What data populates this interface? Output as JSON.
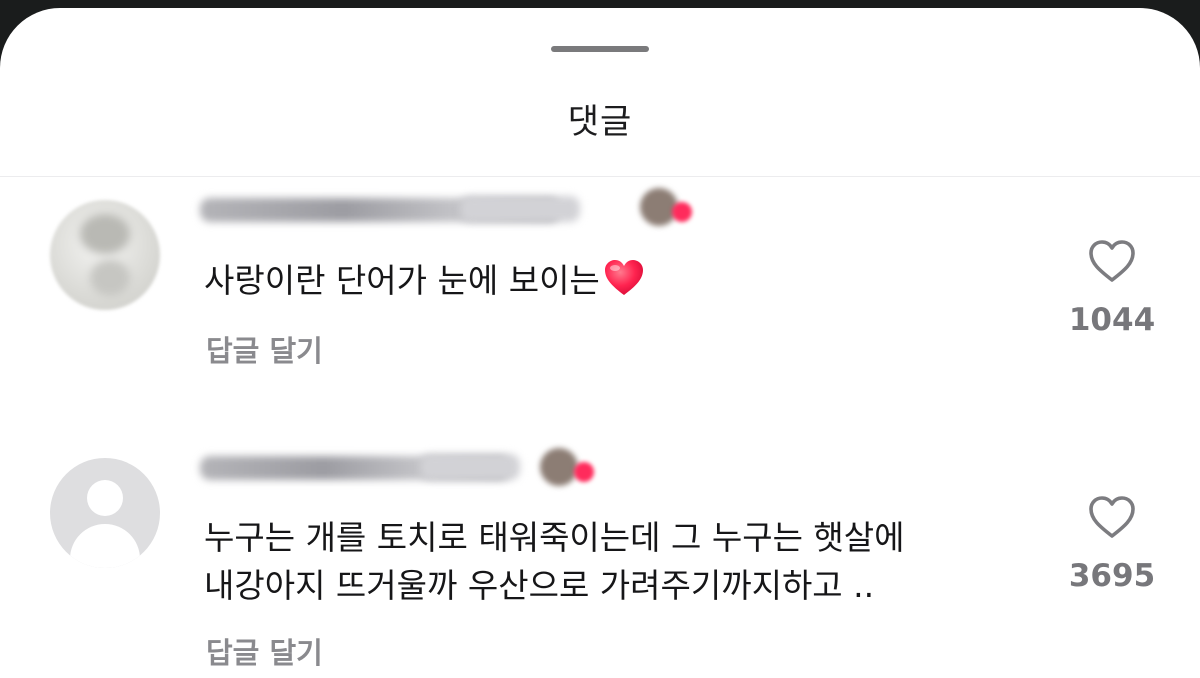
{
  "sheet": {
    "title": "댓글"
  },
  "comments": [
    {
      "text": "사랑이란 단어가 눈에 보이는",
      "emoji": "red-heart-emoji",
      "reply_label": "답글 달기",
      "like_count": "1044"
    },
    {
      "text_line1": "누구는 개를 토치로 태워죽이는데 그 누구는 햇살에",
      "text_line2": "내강아지 뜨거울까 우산으로 가려주기까지하고 ..",
      "reply_label": "답글 달기",
      "like_count": "3695"
    }
  ],
  "colors": {
    "sheet_background": "#ffffff",
    "comment_text": "#161618",
    "secondary_text": "#8a8a8e",
    "heart_accent": "#ff2b5c"
  }
}
